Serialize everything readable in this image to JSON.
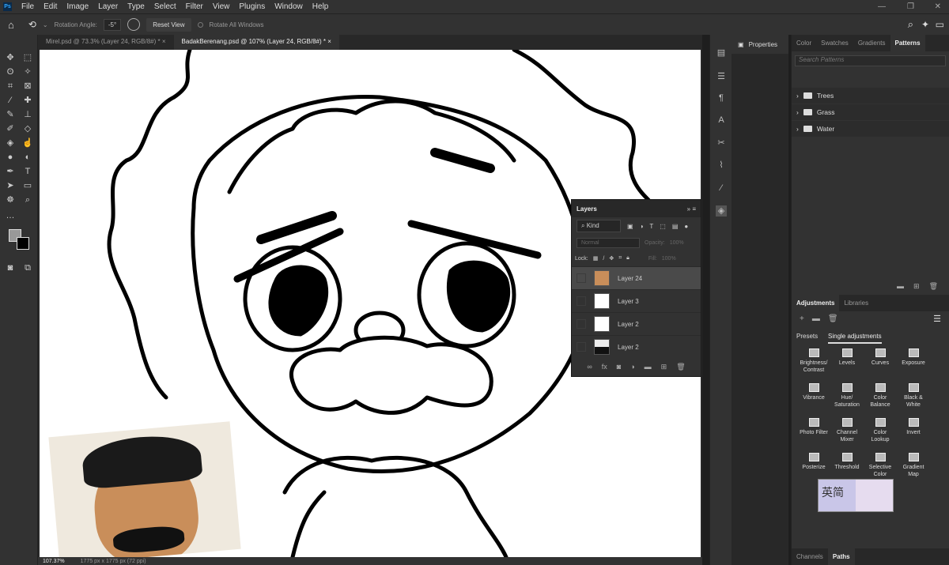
{
  "menu": {
    "logo": "Ps",
    "items": [
      "File",
      "Edit",
      "Image",
      "Layer",
      "Type",
      "Select",
      "Filter",
      "View",
      "Plugins",
      "Window",
      "Help"
    ]
  },
  "options": {
    "rotation_label": "Rotation Angle:",
    "rotation_value": "-5°",
    "reset_view": "Reset View",
    "rotate_all": "Rotate All Windows"
  },
  "doc_tabs": [
    {
      "label": "Mirel.psd @ 73.3% (Layer 24, RGB/8#) *",
      "active": false
    },
    {
      "label": "BadakBerenang.psd @ 107% (Layer 24, RGB/8#) *",
      "active": true
    }
  ],
  "status": {
    "zoom": "107.37%",
    "dims": "1775 px x 1775 px (72 ppi)"
  },
  "layers": {
    "title": "Layers",
    "kind": "Kind",
    "blend": "Normal",
    "opacity_label": "Opacity:",
    "opacity": "100%",
    "lock_label": "Lock:",
    "fill_label": "Fill:",
    "fill": "100%",
    "rows": [
      {
        "name": "Layer 24",
        "selected": true
      },
      {
        "name": "Layer 3",
        "selected": false
      },
      {
        "name": "Layer 2",
        "selected": false
      },
      {
        "name": "Layer 2",
        "selected": false
      }
    ]
  },
  "properties": {
    "title": "Properties"
  },
  "patterns": {
    "tabs": [
      "Color",
      "Swatches",
      "Gradients",
      "Patterns"
    ],
    "active": "Patterns",
    "search_placeholder": "Search Patterns",
    "folders": [
      "Trees",
      "Grass",
      "Water"
    ]
  },
  "adjustments": {
    "tabs": [
      "Adjustments",
      "Libraries"
    ],
    "subtabs": [
      "Presets",
      "Single adjustments"
    ],
    "items": [
      "Brightness/\nContrast",
      "Levels",
      "Curves",
      "Exposure",
      "Vibrance",
      "Hue/\nSaturation",
      "Color\nBalance",
      "Black &\nWhite",
      "Photo Filter",
      "Channel\nMixer",
      "Color\nLookup",
      "Invert",
      "Posterize",
      "Threshold",
      "Selective\nColor",
      "Gradient\nMap"
    ]
  },
  "bottom_tabs": [
    "Channels",
    "Paths"
  ],
  "overlay": {
    "text": "英简"
  },
  "colors": {
    "panel": "#323232",
    "dark": "#282828",
    "accent": "#31a8ff"
  }
}
